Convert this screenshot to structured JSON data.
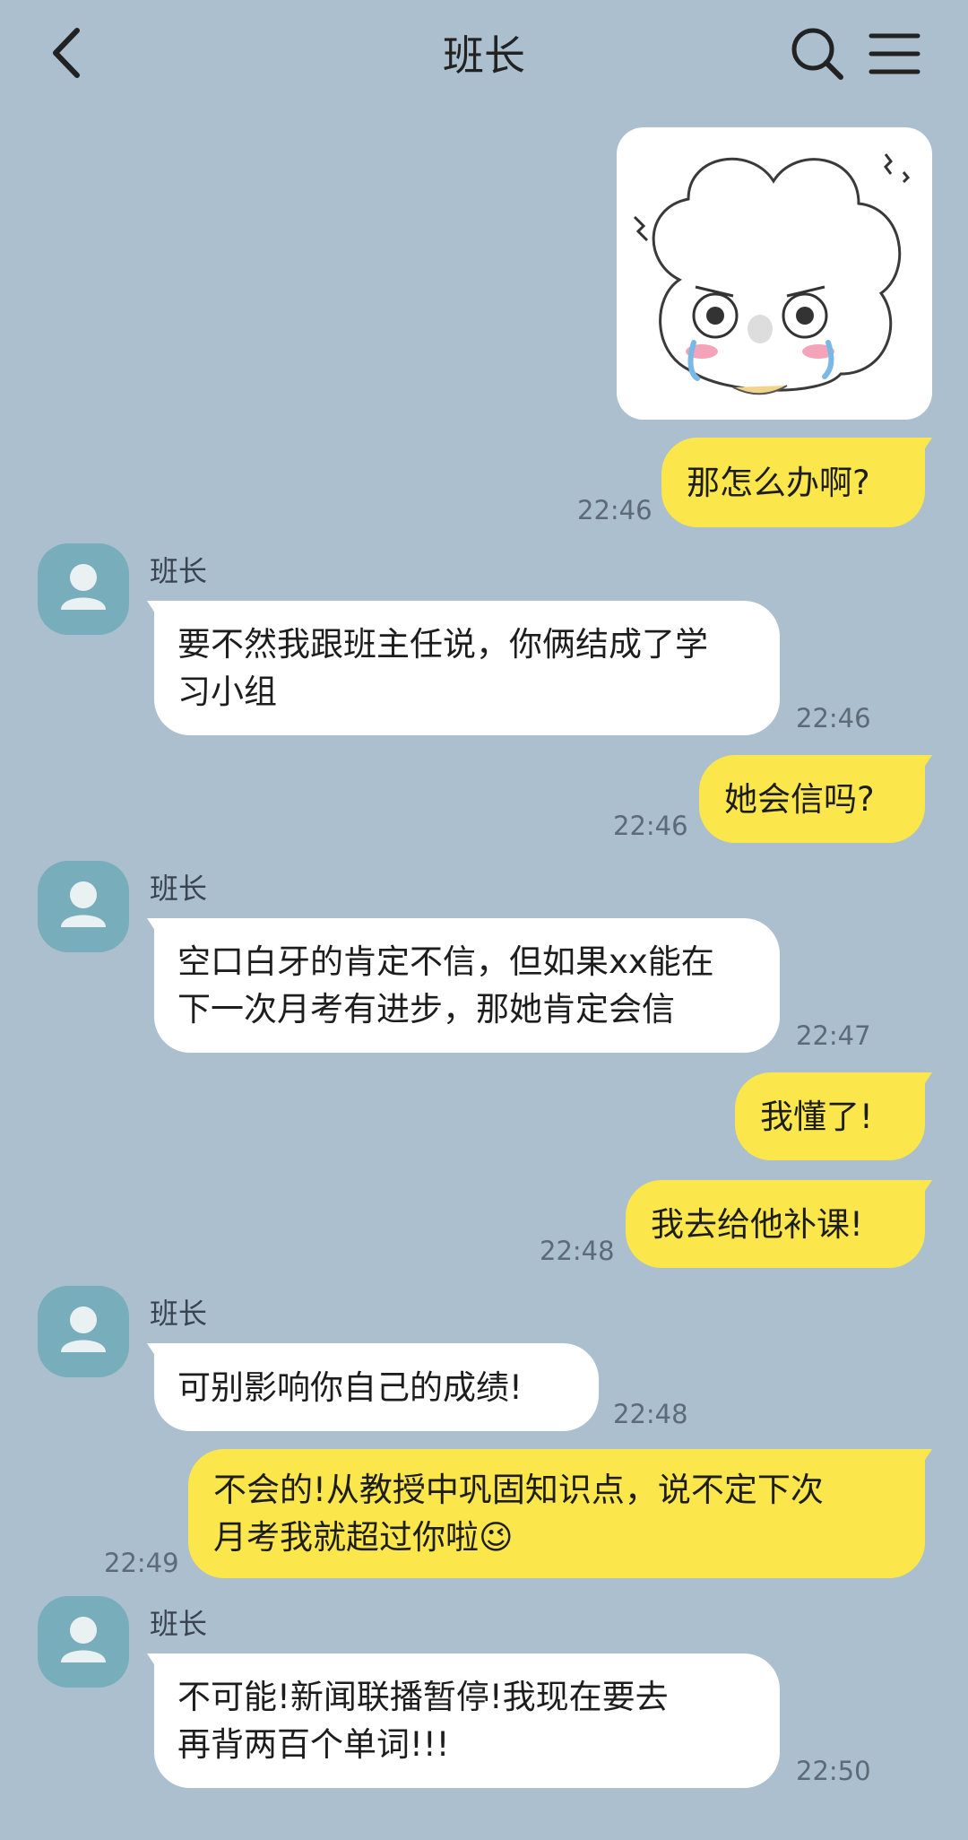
{
  "header": {
    "title": "班长"
  },
  "messages": {
    "m1": {
      "text": "那怎么办啊?",
      "time": "22:46"
    },
    "m2": {
      "sender": "班长",
      "lines": [
        "要不然我跟班主任说，你俩结成了学",
        "习小组"
      ],
      "time": "22:46"
    },
    "m3": {
      "text": "她会信吗?",
      "time": "22:46"
    },
    "m4": {
      "sender": "班长",
      "lines": [
        "空口白牙的肯定不信，但如果xx能在",
        "下一次月考有进步，那她肯定会信"
      ],
      "time": "22:47"
    },
    "m5": {
      "text": "我懂了!"
    },
    "m6": {
      "text": "我去给他补课!",
      "time": "22:48"
    },
    "m7": {
      "sender": "班长",
      "text": "可别影响你自己的成绩!",
      "time": "22:48"
    },
    "m8": {
      "lines": [
        "不会的!从教授中巩固知识点，说不定下次",
        "月考我就超过你啦😉"
      ],
      "time": "22:49"
    },
    "m9": {
      "sender": "班长",
      "lines": [
        "不可能!新闻联播暂停!我现在要去",
        "再背两百个单词!!!"
      ],
      "time": "22:50"
    }
  },
  "colors": {
    "background": "#abbfcf",
    "my_bubble": "#fbe74b",
    "their_bubble": "#ffffff",
    "avatar": "#78aebb"
  }
}
